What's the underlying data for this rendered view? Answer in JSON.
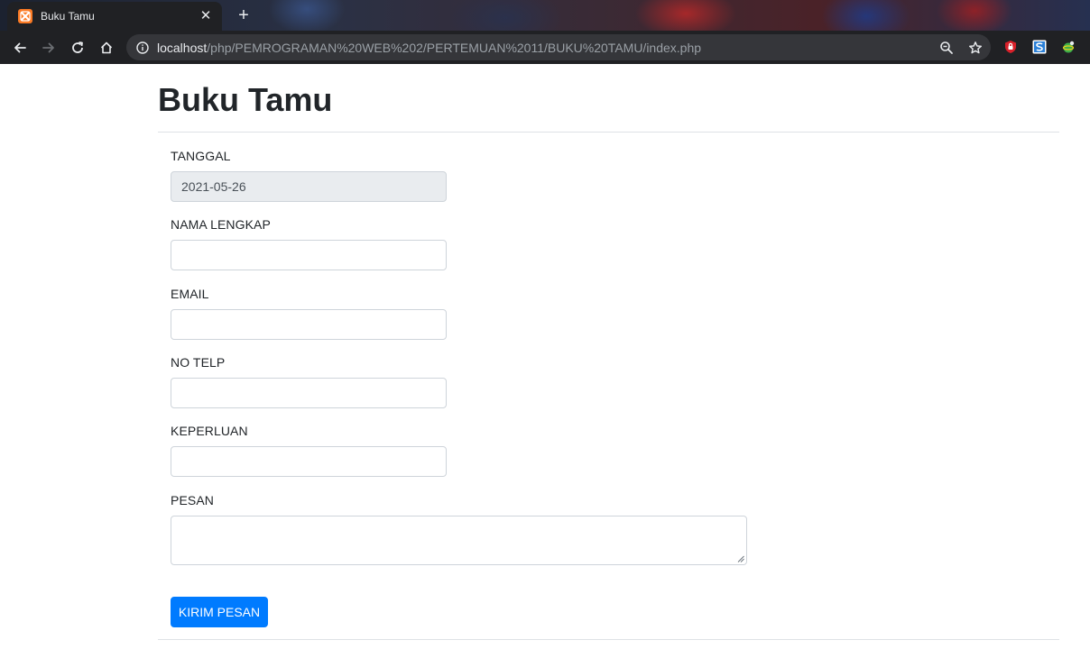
{
  "browser": {
    "tab_title": "Buku Tamu",
    "tab_close": "✕",
    "new_tab": "+",
    "url_host": "localhost",
    "url_path": "/php/PEMROGRAMAN%20WEB%202/PERTEMUAN%2011/BUKU%20TAMU/index.php"
  },
  "page": {
    "title": "Buku Tamu"
  },
  "form": {
    "fields": [
      {
        "label": "TANGGAL",
        "value": "2021-05-26",
        "readonly": true
      },
      {
        "label": "NAMA LENGKAP",
        "value": ""
      },
      {
        "label": "EMAIL",
        "value": ""
      },
      {
        "label": "NO TELP",
        "value": ""
      },
      {
        "label": "KEPERLUAN",
        "value": ""
      }
    ],
    "message_label": "PESAN",
    "message_value": "",
    "submit_label": "KIRIM PESAN"
  },
  "colors": {
    "primary": "#007bff",
    "readonly_bg": "#e9ecef",
    "browser_bg": "#202124"
  },
  "icons": [
    "xampp-favicon-icon",
    "back-icon",
    "forward-icon",
    "reload-icon",
    "home-icon",
    "info-icon",
    "zoom-icon",
    "star-icon",
    "extension-shield-icon",
    "extension-s-icon",
    "extension-globe-icon"
  ]
}
